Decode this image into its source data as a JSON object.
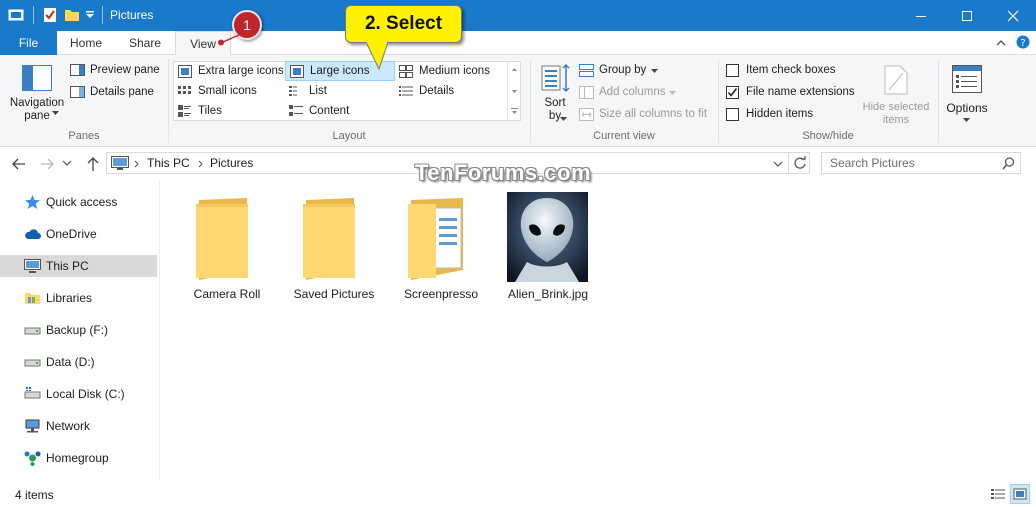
{
  "window": {
    "title": "Pictures"
  },
  "tabs": {
    "file": "File",
    "home": "Home",
    "share": "Share",
    "view": "View"
  },
  "callouts": {
    "step1": "1",
    "step2": "2. Select"
  },
  "ribbon": {
    "panes": {
      "navigation_pane": "Navigation pane",
      "preview_pane": "Preview pane",
      "details_pane": "Details pane",
      "group": "Panes"
    },
    "layout": {
      "items": [
        "Extra large icons",
        "Large icons",
        "Medium icons",
        "Small icons",
        "List",
        "Details",
        "Tiles",
        "Content"
      ],
      "selected": "Large icons",
      "group": "Layout"
    },
    "current_view": {
      "sort_by": "Sort by",
      "group_by": "Group by",
      "add_columns": "Add columns",
      "size_all_columns": "Size all columns to fit",
      "group": "Current view"
    },
    "show_hide": {
      "item_check_boxes": {
        "label": "Item check boxes",
        "checked": false
      },
      "file_name_extensions": {
        "label": "File name extensions",
        "checked": true
      },
      "hidden_items": {
        "label": "Hidden items",
        "checked": false
      },
      "hide_selected": "Hide selected items",
      "group": "Show/hide"
    },
    "options": "Options"
  },
  "address": {
    "crumbs": [
      "This PC",
      "Pictures"
    ],
    "search_placeholder": "Search Pictures"
  },
  "watermark": "TenForums.com",
  "sidebar": {
    "items": [
      "Quick access",
      "OneDrive",
      "This PC",
      "Libraries",
      "Backup (F:)",
      "Data (D:)",
      "Local Disk (C:)",
      "Network",
      "Homegroup"
    ],
    "selected": "This PC"
  },
  "files": [
    "Camera Roll",
    "Saved Pictures",
    "Screenpresso",
    "Alien_Brink.jpg"
  ],
  "status": {
    "count": "4 items"
  },
  "colors": {
    "accent": "#1979ca",
    "selection": "#cce8ff",
    "callout": "#fff200",
    "badge": "#c0262b"
  }
}
